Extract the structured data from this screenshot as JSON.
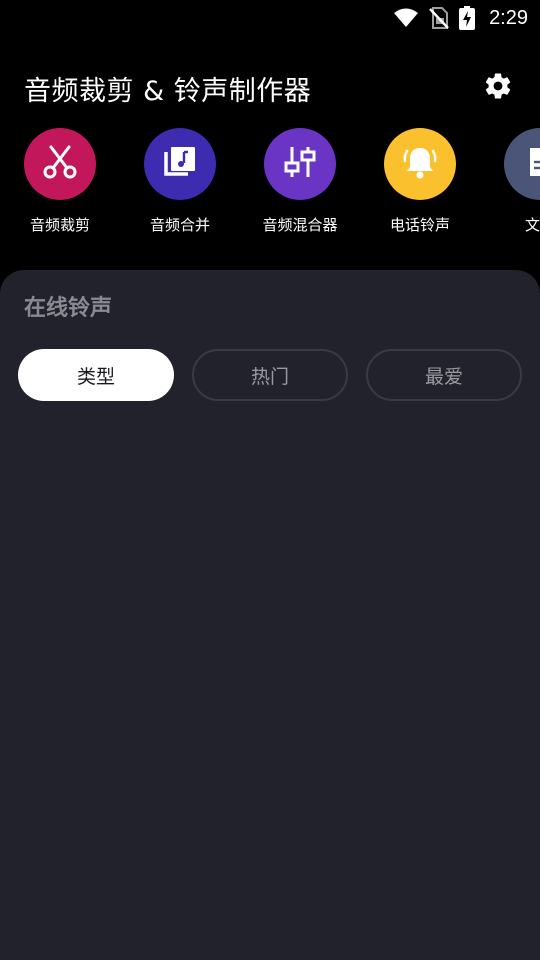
{
  "status_bar": {
    "time": "2:29",
    "icons": [
      "wifi-icon",
      "no-sim-icon",
      "battery-charging-icon"
    ]
  },
  "header": {
    "title": "音频裁剪 & 铃声制作器",
    "settings_icon": "gear-icon"
  },
  "tools": [
    {
      "label": "音频裁剪",
      "icon": "scissors-icon",
      "color": "#c2185b"
    },
    {
      "label": "音频合并",
      "icon": "music-library-icon",
      "color": "#3d2bb0"
    },
    {
      "label": "音频混合器",
      "icon": "equalizer-sliders-icon",
      "color": "#6a35c4"
    },
    {
      "label": "电话铃声",
      "icon": "bell-icon",
      "color": "#fbc02d"
    },
    {
      "label": "文件",
      "icon": "document-icon",
      "color": "#4a5578"
    }
  ],
  "online": {
    "title": "在线铃声",
    "tabs": [
      {
        "label": "类型",
        "active": true
      },
      {
        "label": "热门",
        "active": false
      },
      {
        "label": "最爱",
        "active": false
      }
    ]
  },
  "colors": {
    "background": "#000000",
    "panel": "#22222c",
    "chip_active": "#ffffff",
    "chip_border": "#3a3a44"
  }
}
